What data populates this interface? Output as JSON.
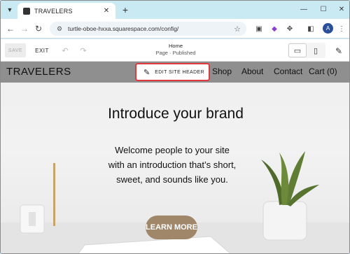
{
  "browser": {
    "tab_title": "TRAVELERS",
    "url": "turtle-oboe-hxxa.squarespace.com/config/",
    "profile_initial": "A"
  },
  "editor": {
    "save_label": "SAVE",
    "exit_label": "EXIT",
    "page_name": "Home",
    "page_status": "Page · Published"
  },
  "site": {
    "logo": "TRAVELERS",
    "edit_header_label": "EDIT SITE HEADER",
    "nav": [
      "Shop",
      "About",
      "Contact",
      "Cart (0)"
    ],
    "hero_title": "Introduce your brand",
    "hero_text": "Welcome people to your site with an introduction that’s short, sweet, and sounds like you.",
    "cta_label": "LEARN MORE"
  },
  "colors": {
    "browser_chrome": "#c9eaf3",
    "header_bg": "#8f8f8f",
    "highlight": "#e0393e",
    "cta_bg": "#a0876a"
  }
}
